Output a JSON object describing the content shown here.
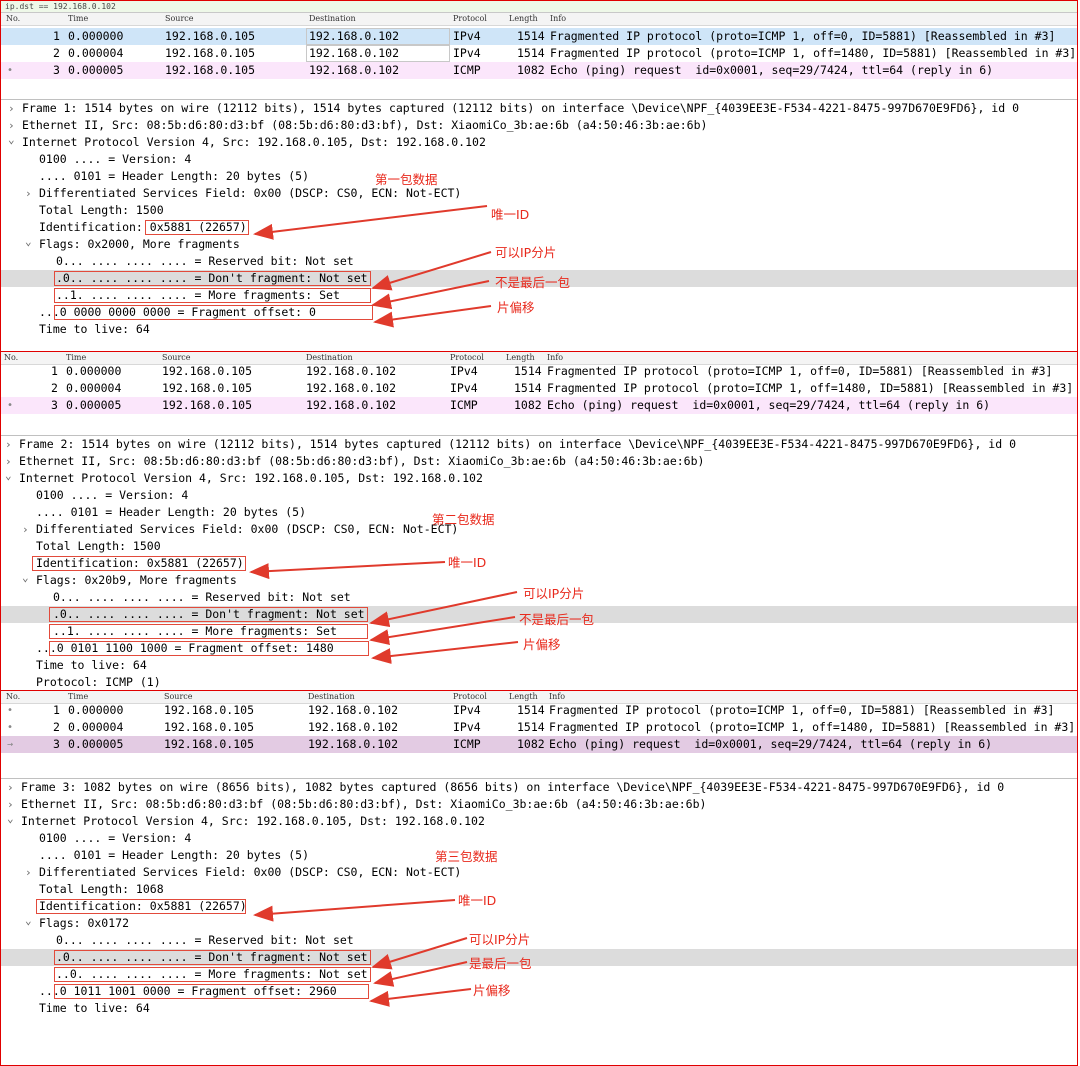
{
  "columns": {
    "no": "No.",
    "time": "Time",
    "source": "Source",
    "destination": "Destination",
    "protocol": "Protocol",
    "length": "Length",
    "info": "Info"
  },
  "top_filter_text": "ip.dst == 192.168.0.102",
  "packets": [
    {
      "no": "1",
      "time": "0.000000",
      "source": "192.168.0.105",
      "destination": "192.168.0.102",
      "protocol": "IPv4",
      "length": "1514",
      "info": "Fragmented IP protocol (proto=ICMP 1, off=0, ID=5881) [Reassembled in #3]"
    },
    {
      "no": "2",
      "time": "0.000004",
      "source": "192.168.0.105",
      "destination": "192.168.0.102",
      "protocol": "IPv4",
      "length": "1514",
      "info": "Fragmented IP protocol (proto=ICMP 1, off=1480, ID=5881) [Reassembled in #3]"
    },
    {
      "no": "3",
      "time": "0.000005",
      "source": "192.168.0.105",
      "destination": "192.168.0.102",
      "protocol": "ICMP",
      "length": "1082",
      "info": "Echo (ping) request  id=0x0001, seq=29/7424, ttl=64 (reply in 6)"
    }
  ],
  "panels": [
    {
      "details": [
        {
          "twisty": ">",
          "text": "Frame 1: 1514 bytes on wire (12112 bits), 1514 bytes captured (12112 bits) on interface \\Device\\NPF_{4039EE3E-F534-4221-8475-997D670E9FD6}, id 0"
        },
        {
          "twisty": ">",
          "text": "Ethernet II, Src: 08:5b:d6:80:d3:bf (08:5b:d6:80:d3:bf), Dst: XiaomiCo_3b:ae:6b (a4:50:46:3b:ae:6b)"
        },
        {
          "twisty": "v",
          "text": "Internet Protocol Version 4, Src: 192.168.0.105, Dst: 192.168.0.102"
        },
        {
          "twisty": "",
          "text": "0100 .... = Version: 4"
        },
        {
          "twisty": "",
          "text": ".... 0101 = Header Length: 20 bytes (5)"
        },
        {
          "twisty": ">",
          "text": "Differentiated Services Field: 0x00 (DSCP: CS0, ECN: Not-ECT)"
        },
        {
          "twisty": "",
          "text": "Total Length: 1500"
        },
        {
          "twisty": "",
          "text": "Identification: 0x5881 (22657)"
        },
        {
          "twisty": "v",
          "text": "Flags: 0x2000, More fragments"
        },
        {
          "twisty": "",
          "text": "0... .... .... .... = Reserved bit: Not set"
        },
        {
          "twisty": "",
          "text": ".0.. .... .... .... = Don't fragment: Not set"
        },
        {
          "twisty": "",
          "text": "..1. .... .... .... = More fragments: Set"
        },
        {
          "twisty": "",
          "text": "...0 0000 0000 0000 = Fragment offset: 0"
        },
        {
          "twisty": "",
          "text": "Time to live: 64"
        }
      ],
      "annotations": [
        "第一包数据",
        "唯一ID",
        "可以IP分片",
        "不是最后一包",
        "片偏移"
      ]
    },
    {
      "details": [
        {
          "twisty": ">",
          "text": "Frame 2: 1514 bytes on wire (12112 bits), 1514 bytes captured (12112 bits) on interface \\Device\\NPF_{4039EE3E-F534-4221-8475-997D670E9FD6}, id 0"
        },
        {
          "twisty": ">",
          "text": "Ethernet II, Src: 08:5b:d6:80:d3:bf (08:5b:d6:80:d3:bf), Dst: XiaomiCo_3b:ae:6b (a4:50:46:3b:ae:6b)"
        },
        {
          "twisty": "v",
          "text": "Internet Protocol Version 4, Src: 192.168.0.105, Dst: 192.168.0.102"
        },
        {
          "twisty": "",
          "text": "0100 .... = Version: 4"
        },
        {
          "twisty": "",
          "text": ".... 0101 = Header Length: 20 bytes (5)"
        },
        {
          "twisty": ">",
          "text": "Differentiated Services Field: 0x00 (DSCP: CS0, ECN: Not-ECT)"
        },
        {
          "twisty": "",
          "text": "Total Length: 1500"
        },
        {
          "twisty": "",
          "text": "Identification: 0x5881 (22657)"
        },
        {
          "twisty": "v",
          "text": "Flags: 0x20b9, More fragments"
        },
        {
          "twisty": "",
          "text": "0... .... .... .... = Reserved bit: Not set"
        },
        {
          "twisty": "",
          "text": ".0.. .... .... .... = Don't fragment: Not set"
        },
        {
          "twisty": "",
          "text": "..1. .... .... .... = More fragments: Set"
        },
        {
          "twisty": "",
          "text": "...0 0101 1100 1000 = Fragment offset: 1480"
        },
        {
          "twisty": "",
          "text": "Time to live: 64"
        },
        {
          "twisty": "",
          "text": "Protocol: ICMP (1)"
        }
      ],
      "annotations": [
        "第二包数据",
        "唯一ID",
        "可以IP分片",
        "不是最后一包",
        "片偏移"
      ]
    },
    {
      "details": [
        {
          "twisty": ">",
          "text": "Frame 3: 1082 bytes on wire (8656 bits), 1082 bytes captured (8656 bits) on interface \\Device\\NPF_{4039EE3E-F534-4221-8475-997D670E9FD6}, id 0"
        },
        {
          "twisty": ">",
          "text": "Ethernet II, Src: 08:5b:d6:80:d3:bf (08:5b:d6:80:d3:bf), Dst: XiaomiCo_3b:ae:6b (a4:50:46:3b:ae:6b)"
        },
        {
          "twisty": "v",
          "text": "Internet Protocol Version 4, Src: 192.168.0.105, Dst: 192.168.0.102"
        },
        {
          "twisty": "",
          "text": "0100 .... = Version: 4"
        },
        {
          "twisty": "",
          "text": ".... 0101 = Header Length: 20 bytes (5)"
        },
        {
          "twisty": ">",
          "text": "Differentiated Services Field: 0x00 (DSCP: CS0, ECN: Not-ECT)"
        },
        {
          "twisty": "",
          "text": "Total Length: 1068"
        },
        {
          "twisty": "",
          "text": "Identification: 0x5881 (22657)"
        },
        {
          "twisty": "v",
          "text": "Flags: 0x0172"
        },
        {
          "twisty": "",
          "text": "0... .... .... .... = Reserved bit: Not set"
        },
        {
          "twisty": "",
          "text": ".0.. .... .... .... = Don't fragment: Not set"
        },
        {
          "twisty": "",
          "text": "..0. .... .... .... = More fragments: Not set"
        },
        {
          "twisty": "",
          "text": "...0 1011 1001 0000 = Fragment offset: 2960"
        },
        {
          "twisty": "",
          "text": "Time to live: 64"
        }
      ],
      "annotations": [
        "第三包数据",
        "唯一ID",
        "可以IP分片",
        "是最后一包",
        "片偏移"
      ]
    }
  ]
}
